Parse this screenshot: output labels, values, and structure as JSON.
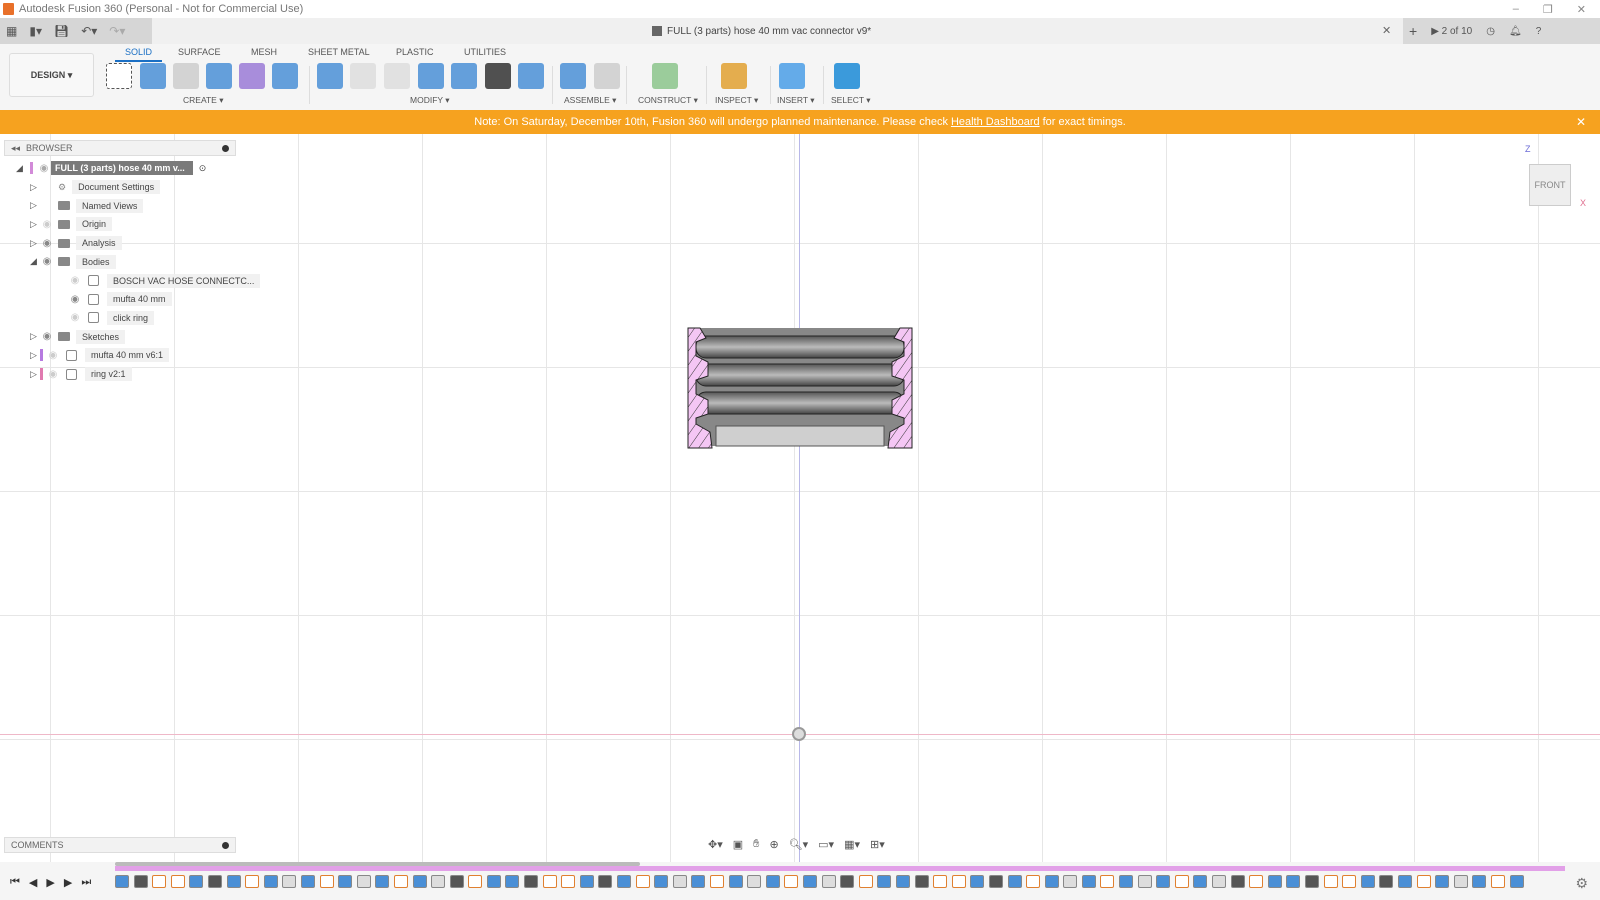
{
  "window": {
    "title": "Autodesk Fusion 360 (Personal - Not for Commercial Use)"
  },
  "document": {
    "tab_title": "FULL (3 parts) hose 40 mm vac connector v9*",
    "jobs": "2 of 10"
  },
  "toolbar": {
    "workspace": "DESIGN ▾",
    "tabs": [
      "SOLID",
      "SURFACE",
      "MESH",
      "SHEET METAL",
      "PLASTIC",
      "UTILITIES"
    ],
    "active_tab": "SOLID",
    "groups": [
      "CREATE ▾",
      "MODIFY ▾",
      "ASSEMBLE ▾",
      "CONSTRUCT ▾",
      "INSPECT ▾",
      "INSERT ▾",
      "SELECT ▾"
    ]
  },
  "banner": {
    "prefix": "Note: On Saturday, December 10th, Fusion 360 will undergo planned maintenance. Please check",
    "link": "Health Dashboard",
    "suffix": "for exact timings."
  },
  "browser": {
    "title": "BROWSER",
    "root": "FULL (3 parts) hose 40 mm v...",
    "items": [
      {
        "label": "Document Settings"
      },
      {
        "label": "Named Views"
      },
      {
        "label": "Origin"
      },
      {
        "label": "Analysis"
      },
      {
        "label": "Bodies"
      },
      {
        "label": "BOSCH VAC HOSE CONNECTC..."
      },
      {
        "label": "mufta 40 mm"
      },
      {
        "label": "click ring"
      },
      {
        "label": "Sketches"
      },
      {
        "label": "mufta 40 mm v6:1"
      },
      {
        "label": "ring v2:1"
      }
    ]
  },
  "comments": {
    "title": "COMMENTS"
  },
  "viewcube": {
    "face": "FRONT",
    "axes": [
      "Z",
      "X"
    ]
  },
  "colors": {
    "accent": "#1a6fc4",
    "banner": "#f6a21f",
    "section_hatch": "#f4c6f4",
    "timeline": "#e2a0e8"
  }
}
